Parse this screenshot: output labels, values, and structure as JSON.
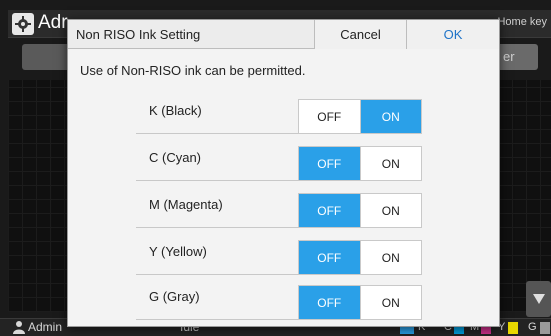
{
  "background": {
    "screen_title": "Adr",
    "home_key": "Home key",
    "right_button": "er",
    "user": "Admin",
    "status": "Idle",
    "ink_indicators": [
      {
        "label": "K",
        "color": "#2aa0e8"
      },
      {
        "label": "C",
        "color": "#00a0e0"
      },
      {
        "label": "M",
        "color": "#d0308c"
      },
      {
        "label": "Y",
        "color": "#e8d800"
      },
      {
        "label": "G",
        "color": "#9a9a9a"
      }
    ]
  },
  "dialog": {
    "title": "Non RISO Ink Setting",
    "cancel": "Cancel",
    "ok": "OK",
    "description": "Use of Non-RISO ink can be permitted.",
    "off_label": "OFF",
    "on_label": "ON",
    "rows": [
      {
        "label": "K (Black)",
        "value": "ON"
      },
      {
        "label": "C (Cyan)",
        "value": "OFF"
      },
      {
        "label": "M (Magenta)",
        "value": "OFF"
      },
      {
        "label": "Y (Yellow)",
        "value": "OFF"
      },
      {
        "label": "G (Gray)",
        "value": "OFF"
      }
    ]
  },
  "colors": {
    "accent": "#2aa0e8",
    "ok_text": "#1e73c8"
  }
}
